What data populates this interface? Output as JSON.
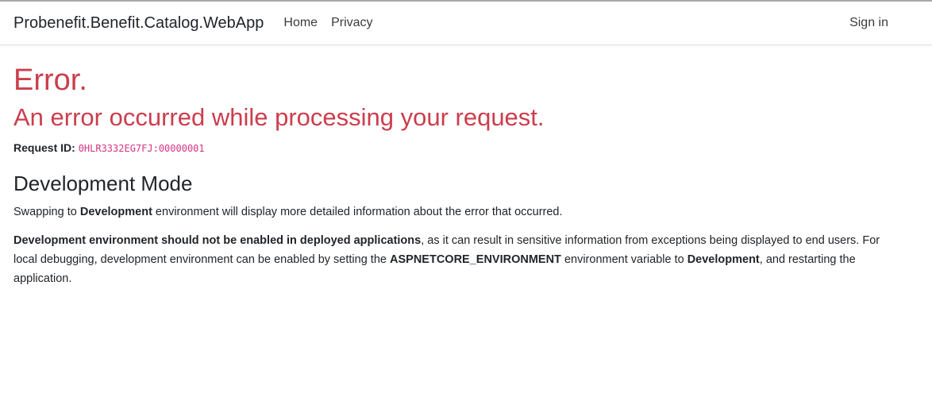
{
  "nav": {
    "brand": "Probenefit.Benefit.Catalog.WebApp",
    "links": [
      "Home",
      "Privacy"
    ],
    "signin": "Sign in"
  },
  "error": {
    "title": "Error.",
    "subtitle": "An error occurred while processing your request.",
    "request_id_label": "Request ID:",
    "request_id": "0HLR3332EG7FJ:00000001"
  },
  "dev": {
    "title": "Development Mode",
    "p1_a": "Swapping to ",
    "p1_b": "Development",
    "p1_c": " environment will display more detailed information about the error that occurred.",
    "p2_a": "Development environment should not be enabled in deployed applications",
    "p2_b": ", as it can result in sensitive information from exceptions being displayed to end users. For local debugging, development environment can be enabled by setting the ",
    "p2_c": "ASPNETCORE_ENVIRONMENT",
    "p2_d": " environment variable to ",
    "p2_e": "Development",
    "p2_f": ", and restarting the application."
  },
  "colors": {
    "danger": "#cb3e4d",
    "code": "#d63384"
  }
}
